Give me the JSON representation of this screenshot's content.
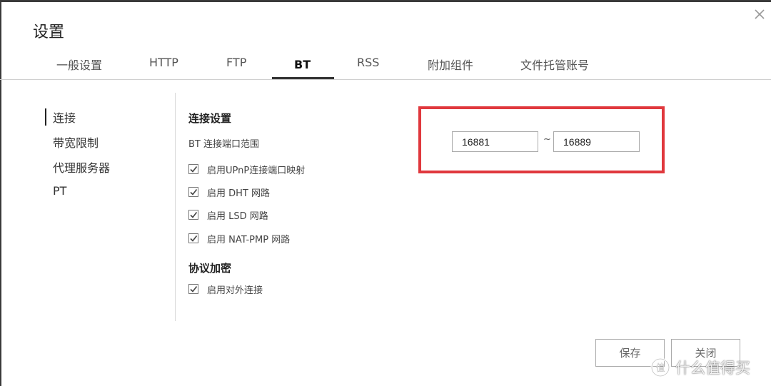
{
  "dialog": {
    "title": "设置"
  },
  "tabs": [
    {
      "label": "一般设置",
      "active": false
    },
    {
      "label": "HTTP",
      "active": false
    },
    {
      "label": "FTP",
      "active": false
    },
    {
      "label": "BT",
      "active": true
    },
    {
      "label": "RSS",
      "active": false
    },
    {
      "label": "附加组件",
      "active": false
    },
    {
      "label": "文件托管账号",
      "active": false
    }
  ],
  "sidebar": {
    "items": [
      {
        "label": "连接",
        "selected": true
      },
      {
        "label": "带宽限制",
        "selected": false
      },
      {
        "label": "代理服务器",
        "selected": false
      },
      {
        "label": "PT",
        "selected": false
      }
    ]
  },
  "connection": {
    "title": "连接设置",
    "port_range_label": "BT 连接端口范围",
    "port_from": "16881",
    "port_separator": "~",
    "port_to": "16889",
    "options": [
      {
        "label": "启用UPnP连接端口映射",
        "checked": true
      },
      {
        "label": "启用 DHT 网路",
        "checked": true
      },
      {
        "label": "启用 LSD 网路",
        "checked": true
      },
      {
        "label": "启用 NAT-PMP 网路",
        "checked": true
      }
    ]
  },
  "encryption": {
    "title": "协议加密",
    "options": [
      {
        "label": "启用对外连接",
        "checked": true
      }
    ]
  },
  "footer": {
    "save_label": "保存",
    "close_label": "关闭"
  },
  "highlight_color": "#e0383d",
  "watermark": {
    "text": "什么值得买"
  },
  "icons": {
    "close": "close-icon",
    "check": "checkmark-icon",
    "watermark": "smzdm-logo-icon"
  }
}
